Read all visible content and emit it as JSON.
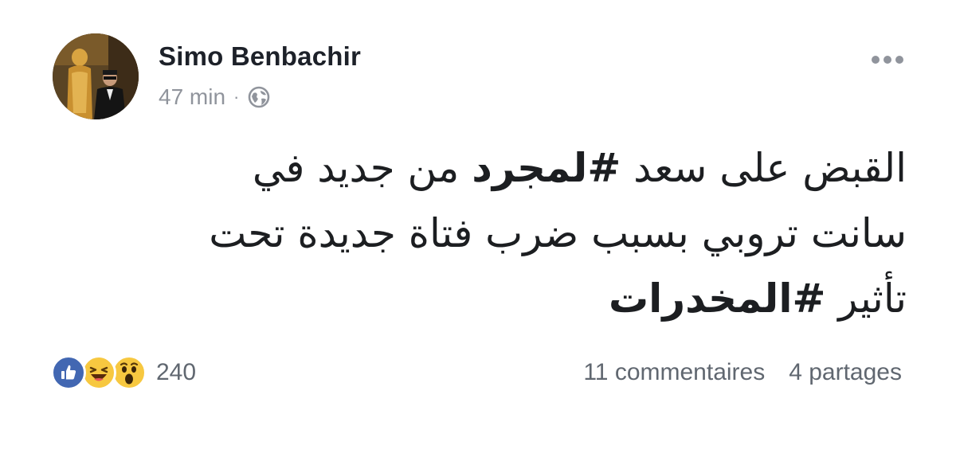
{
  "author": {
    "name": "Simo Benbachir"
  },
  "meta": {
    "time": "47 min",
    "separator": "·",
    "privacy_icon": "globe-icon"
  },
  "menu": {
    "icon": "more-horizontal-icon"
  },
  "post": {
    "segments": [
      {
        "text": "القبض على سعد ",
        "hashtag": false
      },
      {
        "text": "#لمجرد",
        "hashtag": true
      },
      {
        "text": " من جديد في سانت تروبي بسبب ضرب فتاة جديدة تحت تأثير ",
        "hashtag": false
      },
      {
        "text": "#المخدرات",
        "hashtag": true
      }
    ]
  },
  "reactions": {
    "icons": [
      "like-icon",
      "haha-icon",
      "wow-icon"
    ],
    "count": "240"
  },
  "stats": {
    "comments": "11 commentaires",
    "shares": "4 partages"
  },
  "colors": {
    "like_blue": "#4267b2",
    "emoji_yellow": "#f7c840",
    "meta_gray": "#90949c",
    "text": "#1c1e21"
  }
}
